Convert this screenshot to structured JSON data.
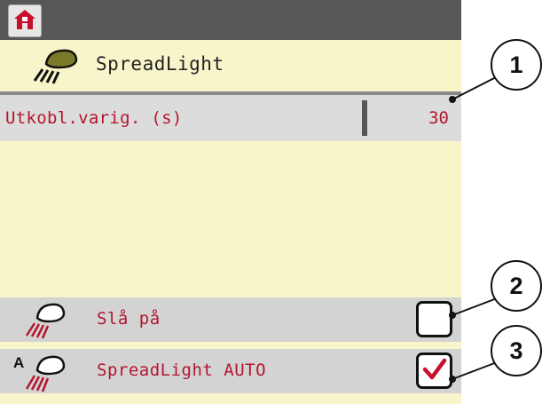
{
  "header": {
    "home_icon": "home-icon"
  },
  "title": {
    "icon": "spreadlight-lamp-icon",
    "text": "SpreadLight"
  },
  "parameter": {
    "label": "Utkobl.varig. (s)",
    "value": "30"
  },
  "toggles": [
    {
      "icon": "lamp-icon",
      "label": "Slå på",
      "checked": false
    },
    {
      "icon": "lamp-auto-icon",
      "label": "SpreadLight AUTO",
      "checked": true
    }
  ],
  "callouts": [
    "1",
    "2",
    "3"
  ],
  "colors": {
    "background": "#f9f5cb",
    "header": "#575757",
    "text_red": "#b3162e",
    "check_red": "#c8102e"
  }
}
